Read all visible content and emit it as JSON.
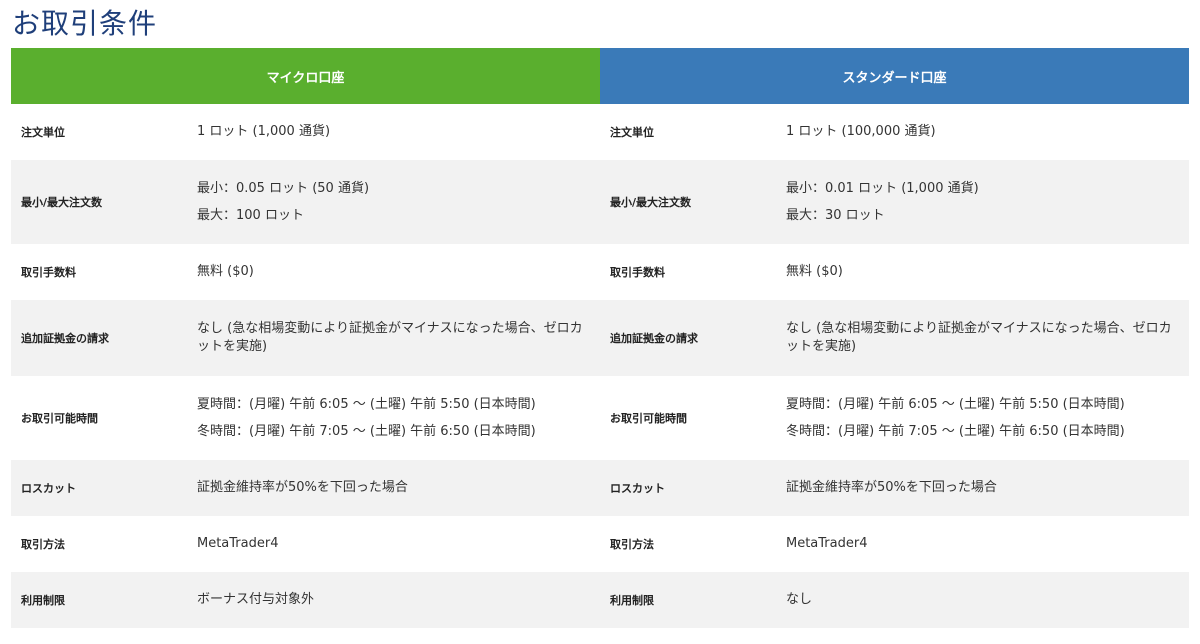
{
  "page": {
    "title": "お取引条件"
  },
  "accounts": [
    {
      "name": "マイクロ口座",
      "header_color": "#5aaf2e",
      "rows": [
        {
          "label": "注文単位",
          "values": [
            "1 ロット (1,000 通貨)"
          ]
        },
        {
          "label": "最小/最大注文数",
          "values": [
            "最小：0.05 ロット (50 通貨)",
            "最大：100 ロット"
          ]
        },
        {
          "label": "取引手数料",
          "values": [
            "無料 ($0)"
          ]
        },
        {
          "label": "追加証拠金の請求",
          "values": [
            "なし (急な相場変動により証拠金がマイナスになった場合、ゼロカットを実施)"
          ]
        },
        {
          "label": "お取引可能時間",
          "values": [
            "夏時間：(月曜) 午前 6:05 〜 (土曜) 午前 5:50 (日本時間)",
            "冬時間：(月曜) 午前 7:05 〜 (土曜) 午前 6:50 (日本時間)"
          ]
        },
        {
          "label": "ロスカット",
          "values": [
            "証拠金維持率が50%を下回った場合"
          ]
        },
        {
          "label": "取引方法",
          "values": [
            "MetaTrader4"
          ]
        },
        {
          "label": "利用制限",
          "values": [
            "ボーナス付与対象外"
          ]
        }
      ]
    },
    {
      "name": "スタンダード口座",
      "header_color": "#3a7ab8",
      "rows": [
        {
          "label": "注文単位",
          "values": [
            "1 ロット (100,000 通貨)"
          ]
        },
        {
          "label": "最小/最大注文数",
          "values": [
            "最小：0.01 ロット (1,000 通貨)",
            "最大：30 ロット"
          ]
        },
        {
          "label": "取引手数料",
          "values": [
            "無料 ($0)"
          ]
        },
        {
          "label": "追加証拠金の請求",
          "values": [
            "なし (急な相場変動により証拠金がマイナスになった場合、ゼロカットを実施)"
          ]
        },
        {
          "label": "お取引可能時間",
          "values": [
            "夏時間：(月曜) 午前 6:05 〜 (土曜) 午前 5:50 (日本時間)",
            "冬時間：(月曜) 午前 7:05 〜 (土曜) 午前 6:50 (日本時間)"
          ]
        },
        {
          "label": "ロスカット",
          "values": [
            "証拠金維持率が50%を下回った場合"
          ]
        },
        {
          "label": "取引方法",
          "values": [
            "MetaTrader4"
          ]
        },
        {
          "label": "利用制限",
          "values": [
            "なし"
          ]
        }
      ]
    }
  ]
}
